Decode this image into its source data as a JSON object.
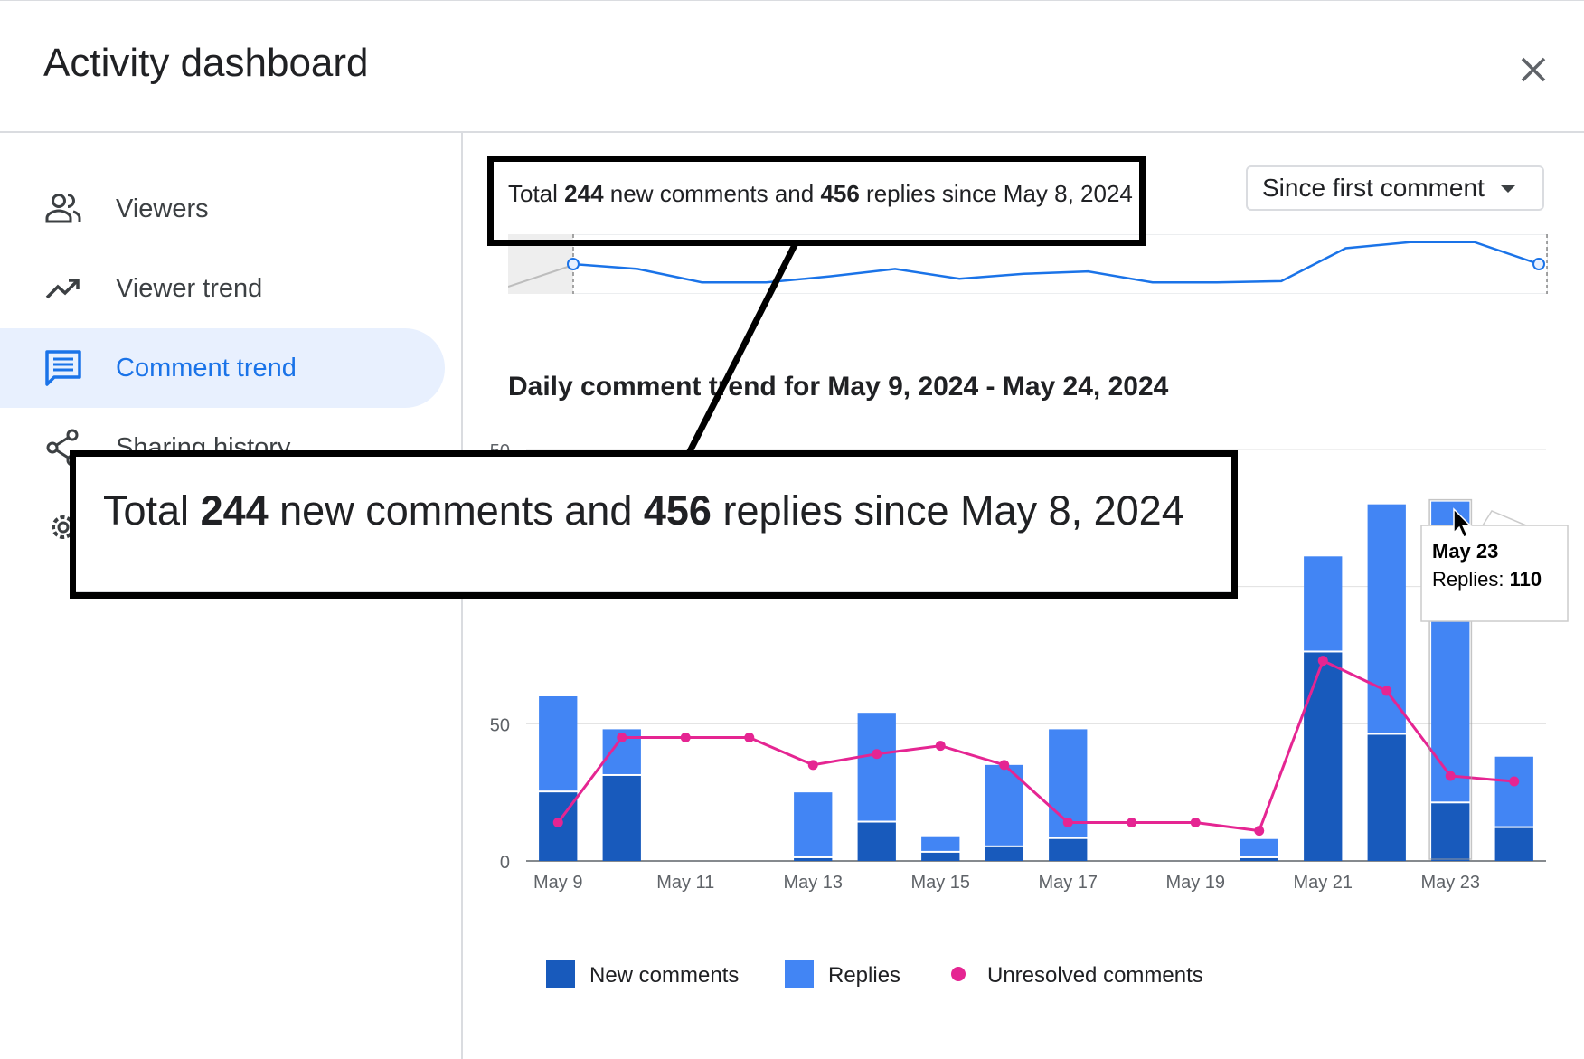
{
  "dialog": {
    "title": "Activity dashboard"
  },
  "sidebar": {
    "items": [
      {
        "label": "Viewers",
        "icon": "people-icon",
        "active": false
      },
      {
        "label": "Viewer trend",
        "icon": "trending-up-icon",
        "active": false
      },
      {
        "label": "Comment trend",
        "icon": "comment-icon",
        "active": true
      },
      {
        "label": "Sharing history",
        "icon": "share-icon",
        "active": false
      },
      {
        "label": "",
        "icon": "gear-icon",
        "active": false
      }
    ]
  },
  "summary": {
    "prefix": "Total ",
    "new_count": "244",
    "middle": " new comments and ",
    "reply_count": "456",
    "suffix": " replies since May 8, 2024"
  },
  "range_select": {
    "value": "Since first comment"
  },
  "chart_heading": "Daily comment trend for May 9, 2024 - May 24, 2024",
  "tooltip": {
    "date": "May 23",
    "label": "Replies: ",
    "value": "110"
  },
  "colors": {
    "new_comments": "#185abc",
    "replies": "#4285f4",
    "unresolved": "#e52592",
    "overview_line": "#1a73e8",
    "active_nav": "#1a73e8"
  },
  "chart_data": {
    "type": "bar",
    "stacked": true,
    "categories": [
      "May 9",
      "May 10",
      "May 11",
      "May 12",
      "May 13",
      "May 14",
      "May 15",
      "May 16",
      "May 17",
      "May 18",
      "May 19",
      "May 20",
      "May 21",
      "May 22",
      "May 23",
      "May 24"
    ],
    "x_tick_labels": [
      "May 9",
      "May 11",
      "May 13",
      "May 15",
      "May 17",
      "May 19",
      "May 21",
      "May 23"
    ],
    "y_ticks": [
      "0",
      "50",
      "150"
    ],
    "ylim": [
      0,
      150
    ],
    "series": [
      {
        "name": "New comments",
        "kind": "bar",
        "values": [
          25,
          31,
          0,
          0,
          1,
          14,
          3,
          5,
          8,
          0,
          0,
          1,
          76,
          46,
          21,
          12
        ]
      },
      {
        "name": "Replies",
        "kind": "bar",
        "values": [
          35,
          17,
          0,
          0,
          24,
          40,
          6,
          30,
          40,
          0,
          0,
          7,
          35,
          84,
          110,
          26
        ]
      },
      {
        "name": "Unresolved comments",
        "kind": "line",
        "values": [
          14,
          45,
          45,
          45,
          35,
          39,
          42,
          35,
          14,
          14,
          14,
          11,
          73,
          62,
          31,
          29
        ]
      }
    ],
    "overview": {
      "type": "line",
      "values": [
        60,
        56,
        45,
        45,
        50,
        56,
        48,
        52,
        54,
        45,
        45,
        46,
        73,
        78,
        78,
        60
      ]
    },
    "legend": [
      "New comments",
      "Replies",
      "Unresolved comments"
    ],
    "legend_position": "bottom"
  }
}
